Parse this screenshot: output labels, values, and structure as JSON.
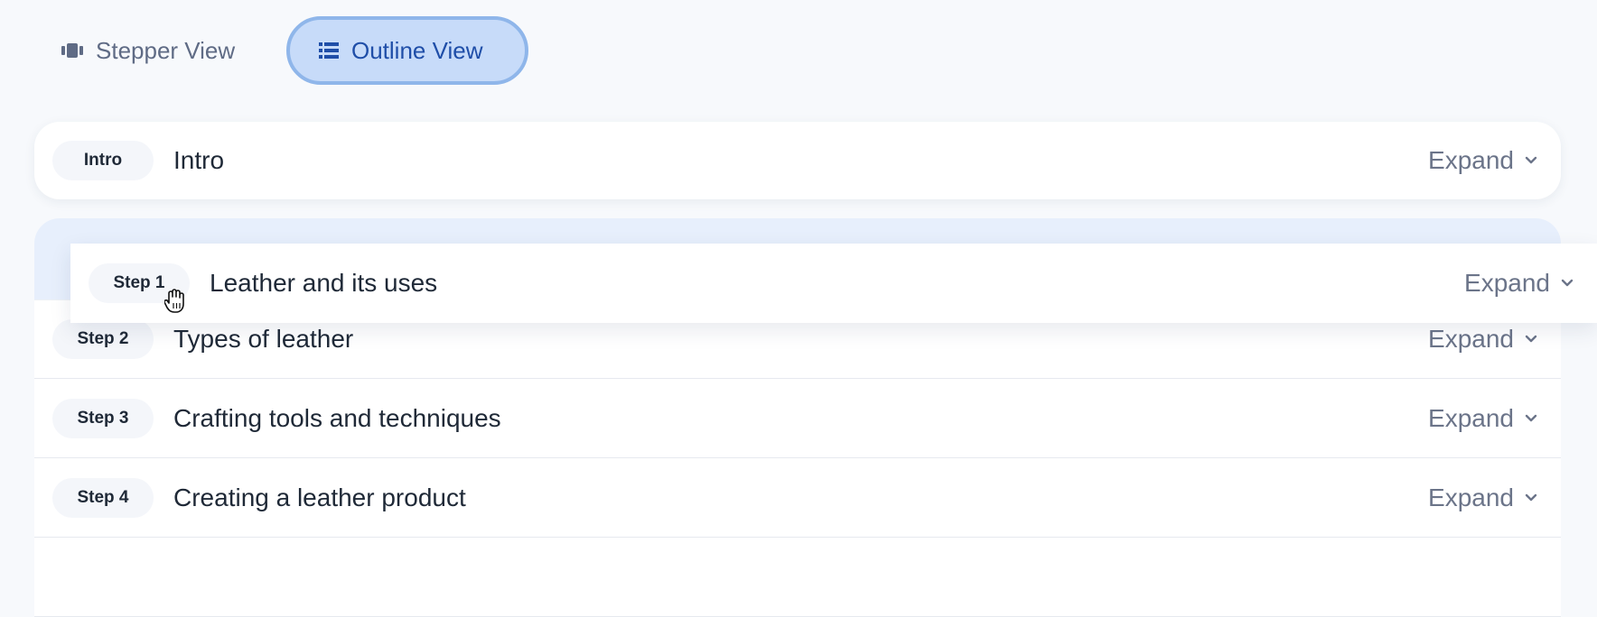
{
  "view_toggle": {
    "stepper_label": "Stepper View",
    "outline_label": "Outline View",
    "active": "outline",
    "accent_color": "#1f4ea8"
  },
  "intro": {
    "badge": "Intro",
    "title": "Intro",
    "expand_label": "Expand"
  },
  "dragging_step": {
    "badge": "Step 1",
    "title": "Leather and its uses",
    "expand_label": "Expand"
  },
  "steps": [
    {
      "badge": "Step 2",
      "title": "Types of leather",
      "expand_label": "Expand"
    },
    {
      "badge": "Step 3",
      "title": "Crafting tools and techniques",
      "expand_label": "Expand"
    },
    {
      "badge": "Step 4",
      "title": "Creating a leather product",
      "expand_label": "Expand"
    }
  ],
  "icons": {
    "stepper": "film-strip-icon",
    "outline": "list-icon",
    "expand": "chevron-down-icon",
    "cursor": "grab-hand-icon"
  }
}
